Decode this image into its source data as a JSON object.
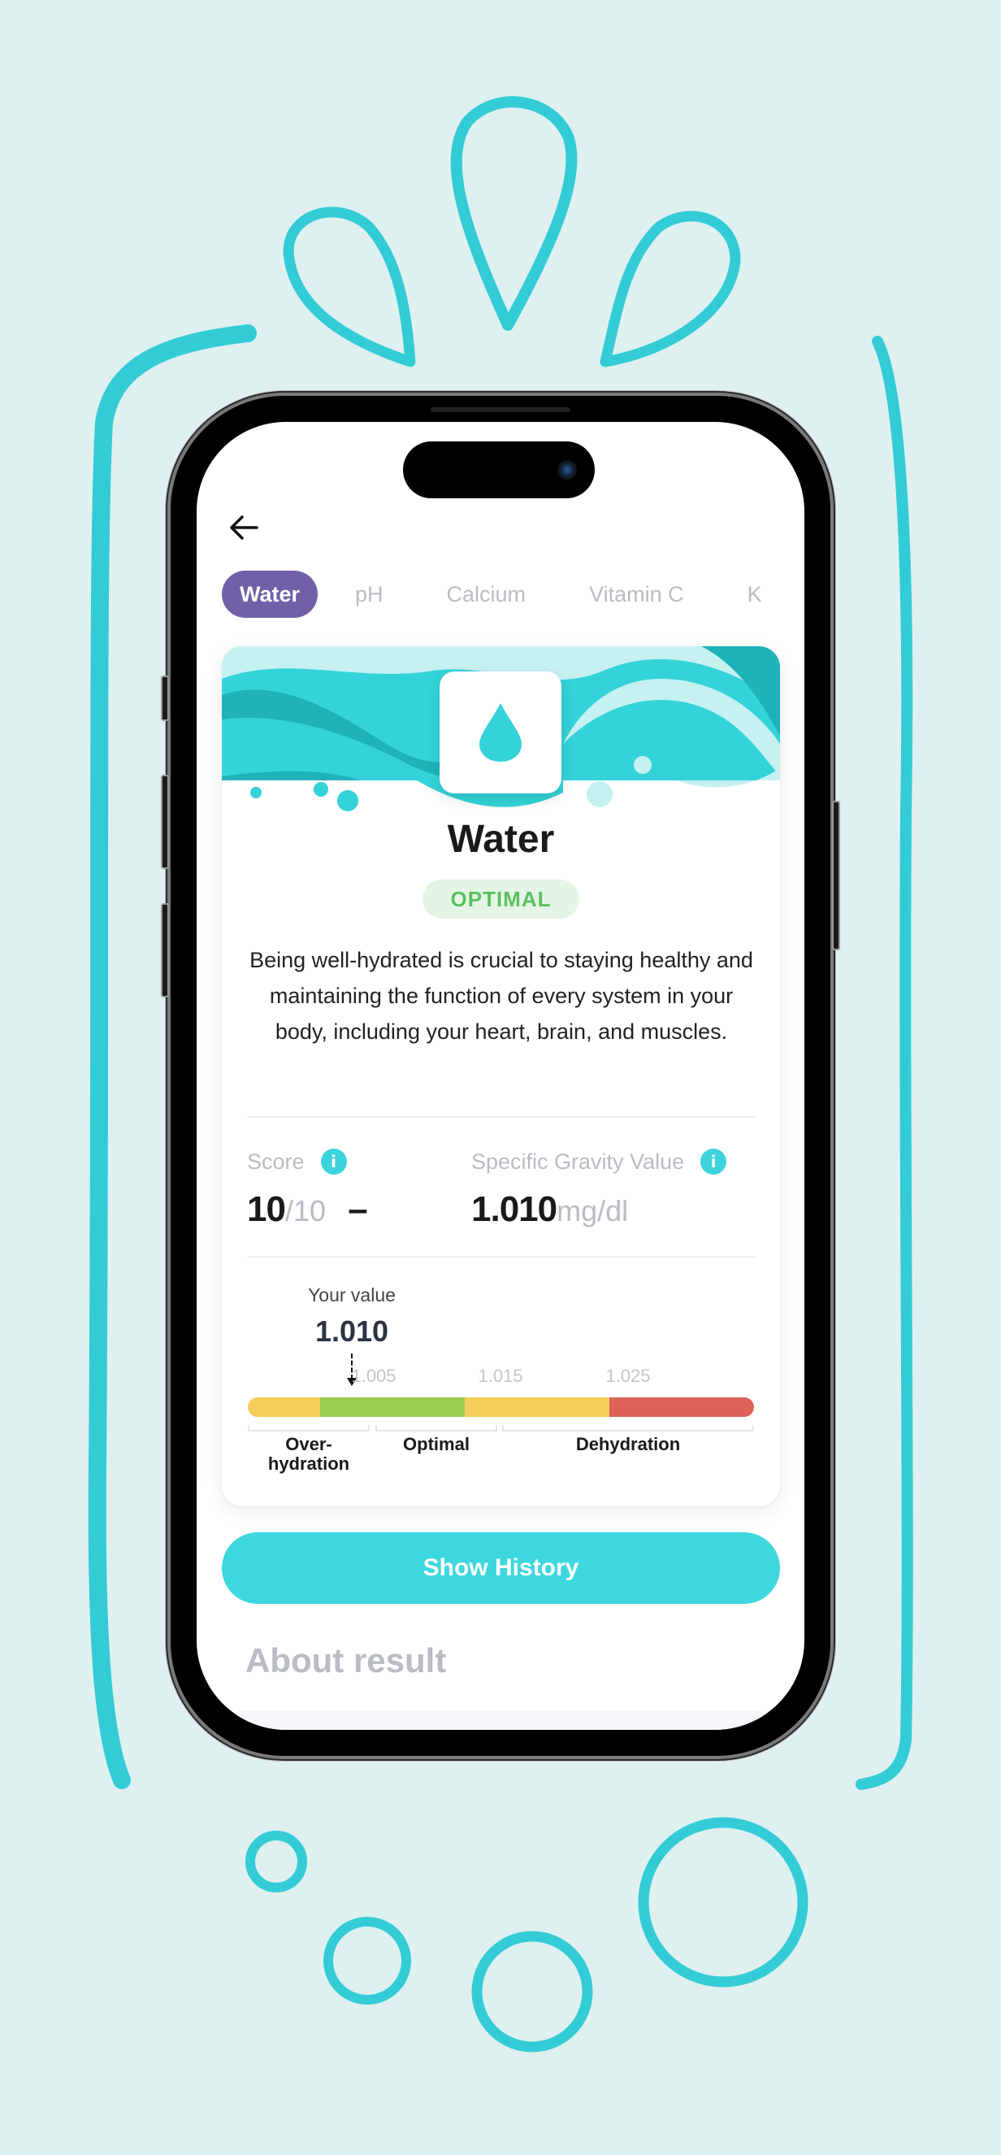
{
  "colors": {
    "background": "#dff0f0",
    "accent_teal": "#3dd8df",
    "tab_active": "#7060a8",
    "optimal_green": "#5cc05f",
    "bar_yellow": "#f5cd5a",
    "bar_green": "#99cc4f",
    "bar_red": "#dd6258"
  },
  "header": {
    "back_icon": "arrow-left-icon"
  },
  "tabs": [
    {
      "label": "Water",
      "active": true
    },
    {
      "label": "pH",
      "active": false
    },
    {
      "label": "Calcium",
      "active": false
    },
    {
      "label": "Vitamin C",
      "active": false
    },
    {
      "label": "K",
      "active": false
    }
  ],
  "card": {
    "icon": "water-drop-icon",
    "title": "Water",
    "status": "OPTIMAL",
    "description": "Being well-hydrated is crucial to staying healthy and maintaining the function of every system in your body, including your heart, brain, and muscles.",
    "score": {
      "label": "Score",
      "value": "10",
      "max": "/10",
      "trend": "–"
    },
    "gravity": {
      "label": "Specific Gravity Value",
      "value": "1.010",
      "unit": "mg/dl"
    },
    "range": {
      "your_value_label": "Your value",
      "your_value": "1.010",
      "value_numeric": 1.01,
      "ticks": [
        "1.005",
        "1.015",
        "1.025"
      ],
      "segments": [
        {
          "color": "#f5cd5a",
          "from": 1.0,
          "to": 1.005
        },
        {
          "color": "#99cc4f",
          "from": 1.005,
          "to": 1.015
        },
        {
          "color": "#f5cd5a",
          "from": 1.015,
          "to": 1.025
        },
        {
          "color": "#dd6258",
          "from": 1.025,
          "to": 1.035
        }
      ],
      "zones": [
        {
          "label": "Over-\nhydration"
        },
        {
          "label": "Optimal"
        },
        {
          "label": "Dehydration"
        }
      ]
    }
  },
  "actions": {
    "show_history": "Show History"
  },
  "sections": {
    "about_result": "About result"
  }
}
